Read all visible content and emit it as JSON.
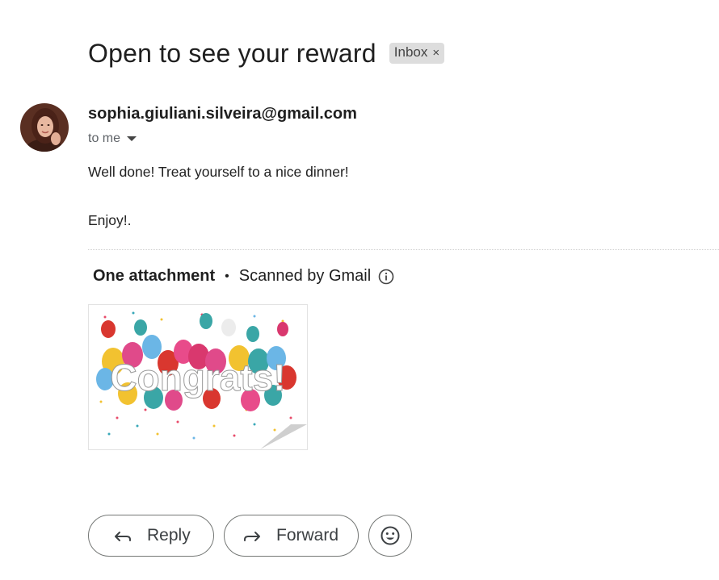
{
  "email": {
    "subject": "Open to see your reward",
    "label": "Inbox",
    "label_close": "×",
    "sender": "sophia.giuliani.silveira@gmail.com",
    "recipient": "to me",
    "body_line1": "Well done! Treat yourself to a nice dinner!",
    "body_line2": "Enjoy!."
  },
  "attachments": {
    "count_label": "One attachment",
    "separator": "•",
    "scan_label": "Scanned by Gmail",
    "image_text": "Congrats!"
  },
  "actions": {
    "reply_label": "Reply",
    "forward_label": "Forward"
  },
  "icons": {
    "info": "info-icon",
    "reply": "reply-arrow-icon",
    "forward": "forward-arrow-icon",
    "emoji": "smiley-icon",
    "dropdown": "caret-down-icon"
  }
}
